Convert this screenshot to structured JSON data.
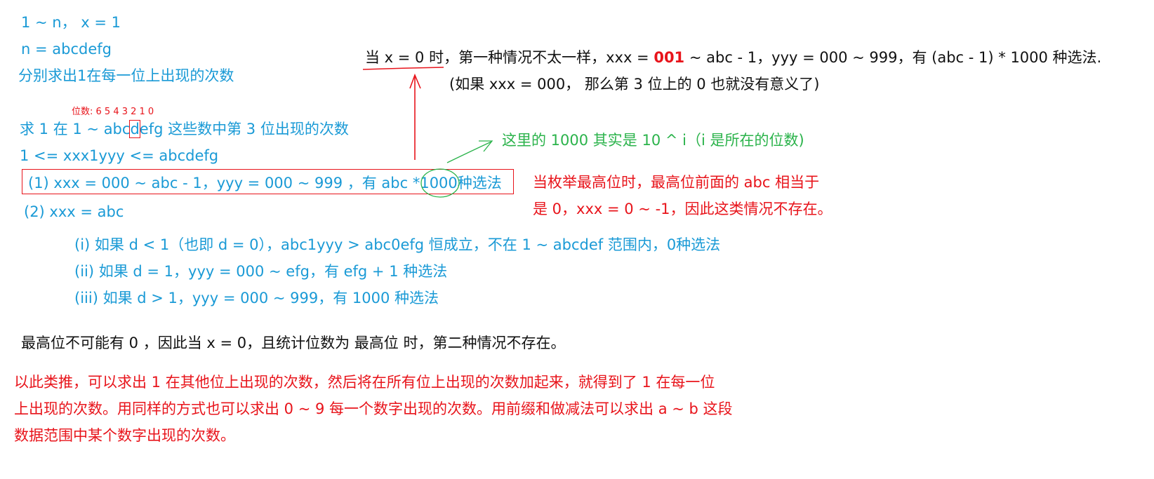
{
  "header": {
    "line1": "1 ~ n， x = 1",
    "line2": "n  = abcdefg",
    "line3": "分别求出1在每一位上出现的次数"
  },
  "digits_label": "位数:  6  5 4 3 2 1 0",
  "main": {
    "title_prefix": "求 1 在 1 ~ abc",
    "title_digit": "d",
    "title_suffix": "efg 这些数中第 3 位出现的次数",
    "range_line": "1 <= xxx1yyy <= abcdefg",
    "case1_prefix": "(1)   xxx = 000 ~ abc - 1，yyy = 000 ~ 999 ，有 abc *",
    "case1_num": "1000",
    "case1_suffix": "种选法",
    "case2": "(2)   xxx = abc",
    "sub1": "(i)  如果 d < 1（也即 d = 0），abc1yyy > abc0efg 恒成立，不在 1 ~ abcdef 范围内，0种选法",
    "sub2": "(ii)  如果 d = 1，yyy = 000 ~ efg，有 efg + 1 种选法",
    "sub3": "(iii)  如果 d > 1，yyy = 000 ~ 999，有 1000 种选法"
  },
  "top_note": {
    "part1": "当 x = 0 时",
    "part2": "，第一种情况不太一样，xxx = ",
    "highlight": "001",
    "part3": " ~ abc - 1，yyy = 000 ~ 999，有 (abc - 1) * 1000 种选法.",
    "paren": "(如果 xxx = 000， 那么第 3 位上的 0 也就没有意义了)"
  },
  "green_note": "这里的 1000 其实是 10 ^ i（i 是所在的位数)",
  "red_note": {
    "line1": "当枚举最高位时，最高位前面的 abc 相当于",
    "line2": "是 0，xxx = 0 ~ -1，因此这类情况不存在。"
  },
  "black_note": "最高位不可能有 0 ，因此当 x = 0，且统计位数为 最高位 时，第二种情况不存在。",
  "conclusion": {
    "line1": "以此类推，可以求出 1 在其他位上出现的次数，然后将在所有位上出现的次数加起来，就得到了 1 在每一位",
    "line2": "上出现的次数。用同样的方式也可以求出 0 ~ 9 每一个数字出现的次数。用前缀和做减法可以求出 a ~ b 这段",
    "line3": "数据范围中某个数字出现的次数。"
  },
  "colors": {
    "blue": "#1a9ad6",
    "red": "#e8141b",
    "green": "#2bb34b",
    "black": "#111111"
  }
}
